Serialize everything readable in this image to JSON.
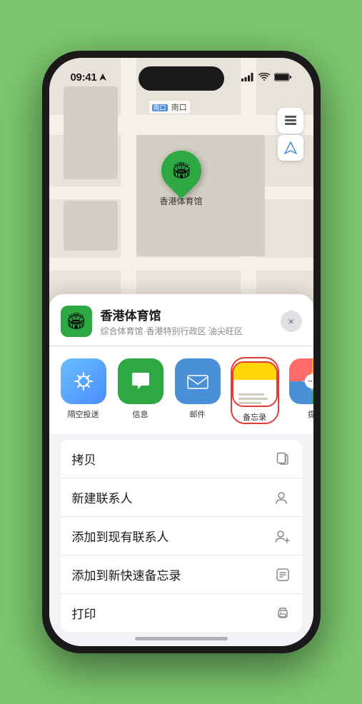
{
  "phone": {
    "status_bar": {
      "time": "09:41",
      "time_icon": "navigation-arrow-icon"
    },
    "map": {
      "label_nankou": "南口",
      "pin_label": "香港体育馆",
      "controls": [
        "map-layers-icon",
        "location-arrow-icon"
      ]
    },
    "bottom_sheet": {
      "close_label": "×",
      "venue": {
        "name": "香港体育馆",
        "subtitle": "综合体育馆·香港特别行政区 油尖旺区"
      },
      "share_items": [
        {
          "id": "airdrop",
          "label": "隔空投送",
          "icon": "airdrop-icon"
        },
        {
          "id": "message",
          "label": "信息",
          "icon": "message-icon"
        },
        {
          "id": "mail",
          "label": "邮件",
          "icon": "mail-icon"
        },
        {
          "id": "notes",
          "label": "备忘录",
          "icon": "notes-icon"
        },
        {
          "id": "more",
          "label": "提",
          "icon": "more-icon"
        }
      ],
      "actions": [
        {
          "id": "copy",
          "label": "拷贝",
          "icon": "📋"
        },
        {
          "id": "new-contact",
          "label": "新建联系人",
          "icon": "👤"
        },
        {
          "id": "add-existing",
          "label": "添加到现有联系人",
          "icon": "👤"
        },
        {
          "id": "quick-note",
          "label": "添加到新快速备忘录",
          "icon": "📝"
        },
        {
          "id": "print",
          "label": "打印",
          "icon": "🖨"
        }
      ]
    }
  }
}
